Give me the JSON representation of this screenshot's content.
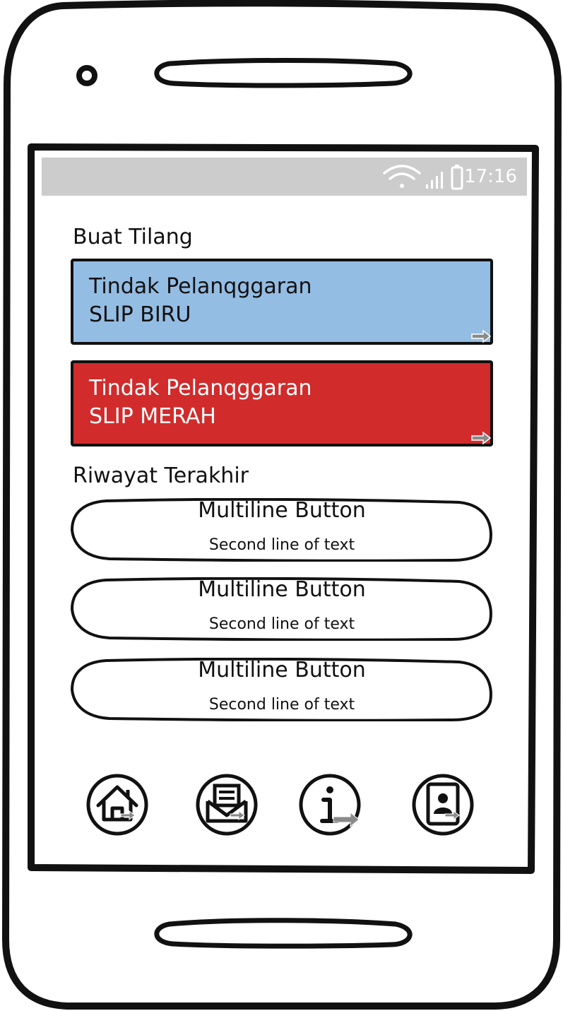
{
  "status_bar": {
    "time": "17:16",
    "icons": [
      "wifi-icon",
      "signal-icon",
      "battery-icon"
    ]
  },
  "sections": {
    "create_ticket_title": "Buat Tilang",
    "recent_history_title": "Riwayat Terakhir"
  },
  "slips": [
    {
      "line1": "Tindak Pelanqggaran",
      "line2": "SLIP BIRU",
      "bg": "#94bde4",
      "text_color": "#111111"
    },
    {
      "line1": "Tindak Pelanqggaran",
      "line2": "SLIP MERAH",
      "bg": "#d12b2b",
      "text_color": "#ffffff"
    }
  ],
  "history_buttons": [
    {
      "label": "Multiline Button",
      "sublabel": "Second line of text"
    },
    {
      "label": "Multiline Button",
      "sublabel": "Second line of text"
    },
    {
      "label": "Multiline Button",
      "sublabel": "Second line of text"
    }
  ],
  "bottom_nav": [
    {
      "icon": "home-icon"
    },
    {
      "icon": "mail-icon"
    },
    {
      "icon": "info-icon"
    },
    {
      "icon": "contact-icon"
    }
  ],
  "colors": {
    "outline": "#111111",
    "status_bar": "#cccccc",
    "slip_blue": "#94bde4",
    "slip_red": "#d12b2b",
    "link_arrow": "#8a8a8a"
  }
}
